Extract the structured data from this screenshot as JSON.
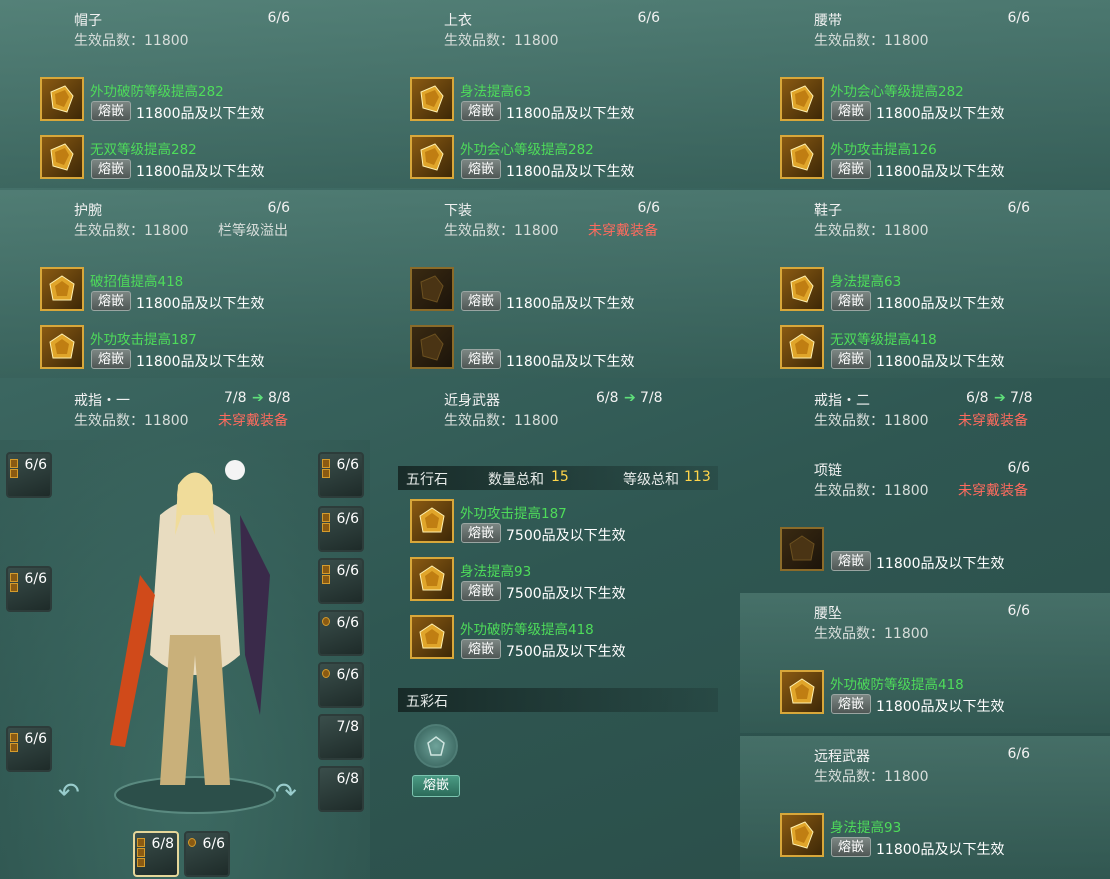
{
  "embed_label": "熔嵌",
  "panels": {
    "hat": {
      "title": "帽子",
      "count": "6/6",
      "level": "生效品数：11800",
      "note": "",
      "gems": [
        {
          "effect": "外功破防等级提高282",
          "req": "11800品及以下生效"
        },
        {
          "effect": "无双等级提高282",
          "req": "11800品及以下生效"
        }
      ]
    },
    "top": {
      "title": "上衣",
      "count": "6/6",
      "level": "生效品数：11800",
      "note": "",
      "gems": [
        {
          "effect": "身法提高63",
          "req": "11800品及以下生效"
        },
        {
          "effect": "外功会心等级提高282",
          "req": "11800品及以下生效"
        }
      ]
    },
    "belt": {
      "title": "腰带",
      "count": "6/6",
      "level": "生效品数：11800",
      "note": "",
      "gems": [
        {
          "effect": "外功会心等级提高282",
          "req": "11800品及以下生效"
        },
        {
          "effect": "外功攻击提高126",
          "req": "11800品及以下生效"
        }
      ]
    },
    "wrist": {
      "title": "护腕",
      "count": "6/6",
      "level": "生效品数：11800",
      "note": "栏等级溢出",
      "gems": [
        {
          "effect": "破招值提高418",
          "req": "11800品及以下生效"
        },
        {
          "effect": "外功攻击提高187",
          "req": "11800品及以下生效"
        }
      ]
    },
    "pants": {
      "title": "下装",
      "count": "6/6",
      "level": "生效品数：11800",
      "note": "未穿戴装备",
      "gems": [
        {
          "effect": "",
          "req": "11800品及以下生效"
        },
        {
          "effect": "",
          "req": "11800品及以下生效"
        }
      ]
    },
    "shoes": {
      "title": "鞋子",
      "count": "6/6",
      "level": "生效品数：11800",
      "note": "",
      "gems": [
        {
          "effect": "身法提高63",
          "req": "11800品及以下生效"
        },
        {
          "effect": "无双等级提高418",
          "req": "11800品及以下生效"
        }
      ]
    },
    "ring1": {
      "title": "戒指・一",
      "count_from": "7/8",
      "count_to": "8/8",
      "level": "生效品数：11800",
      "note": "未穿戴装备"
    },
    "melee": {
      "title": "近身武器",
      "count_from": "6/8",
      "count_to": "7/8",
      "level": "生效品数：11800"
    },
    "ring2": {
      "title": "戒指・二",
      "count_from": "6/8",
      "count_to": "7/8",
      "level": "生效品数：11800",
      "note": "未穿戴装备"
    },
    "necklace": {
      "title": "项链",
      "count": "6/6",
      "level": "生效品数：11800",
      "note": "未穿戴装备",
      "gems": [
        {
          "effect": "",
          "req": "11800品及以下生效"
        }
      ]
    },
    "pendant": {
      "title": "腰坠",
      "count": "6/6",
      "level": "生效品数：11800",
      "gems": [
        {
          "effect": "外功破防等级提高418",
          "req": "11800品及以下生效"
        }
      ]
    },
    "ranged": {
      "title": "远程武器",
      "count": "6/6",
      "level": "生效品数：11800",
      "gems": [
        {
          "effect": "身法提高93",
          "req": "11800品及以下生效"
        }
      ]
    }
  },
  "wuxing": {
    "title": "五行石",
    "qty_label": "数量总和",
    "qty_value": "15",
    "lvl_label": "等级总和",
    "lvl_value": "113",
    "gems": [
      {
        "effect": "外功攻击提高187",
        "req": "7500品及以下生效"
      },
      {
        "effect": "身法提高93",
        "req": "7500品及以下生效"
      },
      {
        "effect": "外功破防等级提高418",
        "req": "7500品及以下生效"
      }
    ]
  },
  "wucai": {
    "title": "五彩石",
    "button": "熔嵌"
  },
  "equip_slots": {
    "left": [
      "6/6",
      "6/6",
      "6/6"
    ],
    "right": [
      "6/6",
      "6/6",
      "6/6",
      "6/6",
      "6/6",
      "7/8",
      "6/8"
    ],
    "bottom": [
      "6/8",
      "6/6"
    ]
  },
  "colors": {
    "effect_green": "#4edc5a",
    "warning_red": "#ff6b5e",
    "highlight_yellow": "#ffd54a",
    "gem_border": "#d8a73a"
  }
}
